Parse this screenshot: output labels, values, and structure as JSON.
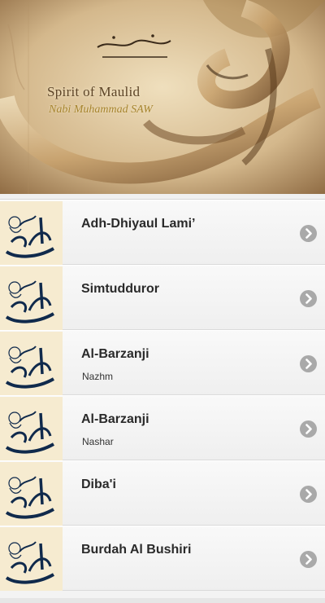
{
  "header": {
    "title": "Spirit of Maulid",
    "subtitle": "Nabi Muhammad SAW"
  },
  "list": {
    "items": [
      {
        "title": "Adh-Dhiyaul Lami’",
        "subtitle": "",
        "icon": "calligraphy-thumbnail",
        "action_icon": "chevron-right-icon"
      },
      {
        "title": "Simtudduror",
        "subtitle": "",
        "icon": "calligraphy-thumbnail",
        "action_icon": "chevron-right-icon"
      },
      {
        "title": "Al-Barzanji",
        "subtitle": "Nazhm",
        "icon": "calligraphy-thumbnail",
        "action_icon": "chevron-right-icon"
      },
      {
        "title": "Al-Barzanji",
        "subtitle": "Nashar",
        "icon": "calligraphy-thumbnail",
        "action_icon": "chevron-right-icon"
      },
      {
        "title": "Diba'i",
        "subtitle": "",
        "icon": "calligraphy-thumbnail",
        "action_icon": "chevron-right-icon"
      },
      {
        "title": "Burdah Al Bushiri",
        "subtitle": "",
        "icon": "calligraphy-thumbnail",
        "action_icon": "chevron-right-icon"
      }
    ]
  },
  "colors": {
    "banner_parchment": "#c9ab7e",
    "calligraphy_ink": "#102a4c",
    "chevron_badge": "#a9a9a9",
    "list_background": "#f3f3f3"
  }
}
